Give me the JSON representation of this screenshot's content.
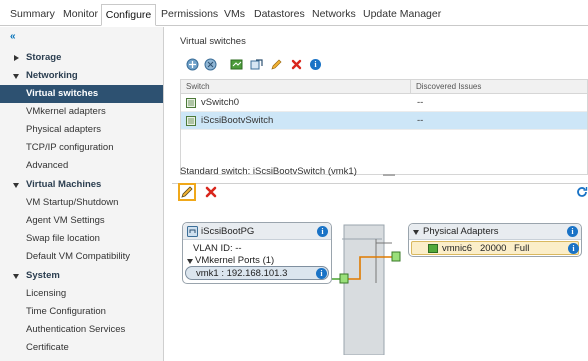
{
  "tabs": [
    "Summary",
    "Monitor",
    "Configure",
    "Permissions",
    "VMs",
    "Datastores",
    "Networks",
    "Update Manager"
  ],
  "active_tab": "Configure",
  "sidebar": {
    "collapse_glyph": "«",
    "items": [
      {
        "label": "Storage",
        "kind": "group",
        "expanded": false
      },
      {
        "label": "Networking",
        "kind": "group",
        "expanded": true
      },
      {
        "label": "Virtual switches",
        "kind": "child",
        "selected": true
      },
      {
        "label": "VMkernel adapters",
        "kind": "child"
      },
      {
        "label": "Physical adapters",
        "kind": "child"
      },
      {
        "label": "TCP/IP configuration",
        "kind": "child"
      },
      {
        "label": "Advanced",
        "kind": "child"
      },
      {
        "label": "Virtual Machines",
        "kind": "group",
        "expanded": true
      },
      {
        "label": "VM Startup/Shutdown",
        "kind": "child"
      },
      {
        "label": "Agent VM Settings",
        "kind": "child"
      },
      {
        "label": "Swap file location",
        "kind": "child"
      },
      {
        "label": "Default VM Compatibility",
        "kind": "child"
      },
      {
        "label": "System",
        "kind": "group",
        "expanded": true
      },
      {
        "label": "Licensing",
        "kind": "child"
      },
      {
        "label": "Time Configuration",
        "kind": "child"
      },
      {
        "label": "Authentication Services",
        "kind": "child"
      },
      {
        "label": "Certificate",
        "kind": "child"
      }
    ]
  },
  "virtual_switches": {
    "title": "Virtual switches",
    "toolbar_icons": [
      "add-networking-icon",
      "refresh-host-icon",
      "migrate-icon",
      "move-icon",
      "edit-pencil-icon",
      "delete-icon",
      "info-icon"
    ],
    "columns": [
      "Switch",
      "Discovered Issues"
    ],
    "rows": [
      {
        "switch": "vSwitch0",
        "issues": "--"
      },
      {
        "switch": "iScsiBootvSwitch",
        "issues": "--",
        "selected": true
      }
    ]
  },
  "standard_switch": {
    "title": "Standard switch: iScsiBootvSwitch (vmk1)",
    "portgroup": {
      "name": "iScsiBootPG",
      "vlan": "VLAN ID: --",
      "vmkernel_ports": "VMkernel Ports (1)",
      "vmk": "vmk1 : 192.168.101.3"
    },
    "physical_adapters": {
      "title": "Physical Adapters",
      "nic": "vmnic6",
      "speed": "20000",
      "duplex": "Full"
    }
  },
  "colors": {
    "selected_sidebar": "#2d5171",
    "selected_row": "#cde6f7",
    "accent_orange": "#f0a81a",
    "delete_red": "#d9261c",
    "info_blue": "#1a73c6",
    "link_orange": "#e07b00",
    "port_green": "#52a93a"
  }
}
